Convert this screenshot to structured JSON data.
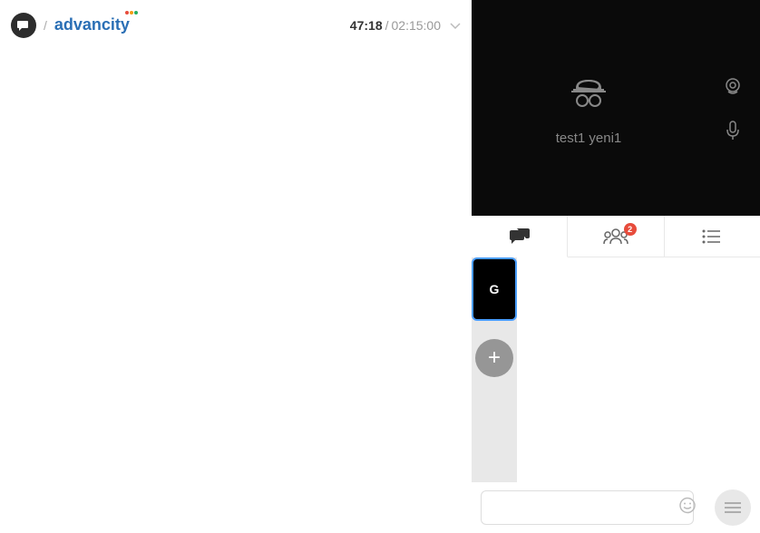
{
  "header": {
    "slash": "/",
    "brand": "advancity",
    "timer_current": "47:18",
    "timer_sep": "/",
    "timer_total": "02:15:00"
  },
  "video": {
    "user_name": "test1 yeni1"
  },
  "tabs": {
    "participants_badge": "2"
  },
  "chat": {
    "sidebar_tile": "G",
    "add_label": "+",
    "input_placeholder": ""
  },
  "colors": {
    "accent": "#4a9eff",
    "badge": "#e74c3c",
    "brand": "#2a6fb5"
  }
}
